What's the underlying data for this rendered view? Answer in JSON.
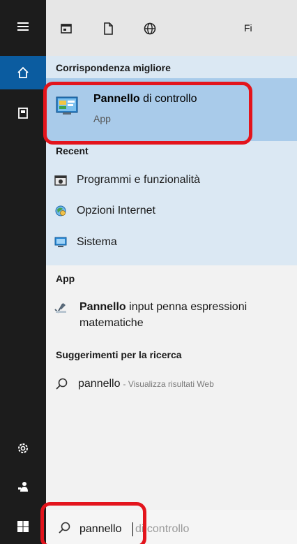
{
  "topbar": {
    "icons": [
      "apps-filter-icon",
      "documents-filter-icon",
      "web-filter-icon"
    ],
    "more_label": "Fi"
  },
  "rail": {
    "icons": [
      "hamburger-menu-icon",
      "home-icon",
      "notebook-icon",
      "settings-icon",
      "feedback-icon",
      "windows-start-icon"
    ]
  },
  "best_match": {
    "section_title": "Corrispondenza migliore",
    "title_bold": "Pannello",
    "title_rest": " di controllo",
    "subtitle": "App"
  },
  "recent": {
    "section_title": "Recent",
    "items": [
      {
        "label": "Programmi e funzionalità",
        "icon": "programs-features-icon"
      },
      {
        "label": "Opzioni Internet",
        "icon": "internet-options-icon"
      },
      {
        "label": "Sistema",
        "icon": "system-icon"
      }
    ]
  },
  "apps": {
    "section_title": "App",
    "item_bold": "Pannello",
    "item_rest": " input penna espressioni matematiche",
    "icon": "math-input-icon"
  },
  "suggestions": {
    "section_title": "Suggerimenti per la ricerca",
    "term": "pannello",
    "suffix": " - Visualizza risultati Web"
  },
  "search": {
    "typed": "pannello",
    "autocomplete": "di controllo"
  },
  "colors": {
    "rail": "#1c1c1c",
    "rail_active": "#0b5ca0",
    "best_match_bg": "#a9cbea",
    "panel_bg": "#dbe8f3",
    "annotation": "#e3141c"
  }
}
